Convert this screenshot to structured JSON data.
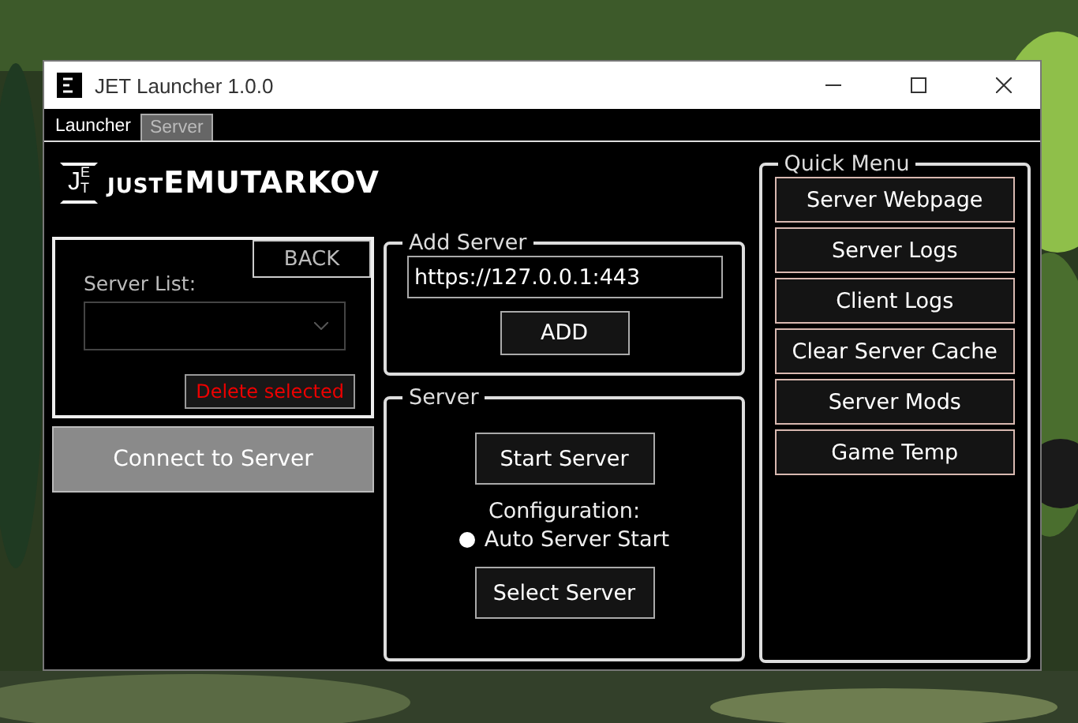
{
  "window": {
    "title": "JET Launcher 1.0.0"
  },
  "tabs": [
    {
      "label": "Launcher",
      "selected": true
    },
    {
      "label": "Server",
      "selected": false
    }
  ],
  "logo": {
    "mark": [
      "J",
      "E",
      "T"
    ],
    "prefix": "JUST",
    "name": "EMUTARKOV"
  },
  "server_list": {
    "back_button": "BACK",
    "label": "Server List:",
    "delete_button": "Delete selected"
  },
  "connect_button": {
    "label": "Connect to Server",
    "disabled": true
  },
  "add_server": {
    "title": "Add Server",
    "value": "https://127.0.0.1:443",
    "button": "ADD"
  },
  "server": {
    "title": "Server",
    "start_button": "Start Server",
    "config_label": "Configuration:",
    "auto_start": {
      "label": "Auto Server Start",
      "checked": false
    },
    "select_button": "Select Server"
  },
  "quick_menu": {
    "title": "Quick Menu",
    "items": [
      "Server Webpage",
      "Server Logs",
      "Client Logs",
      "Clear Server Cache",
      "Server Mods",
      "Game Temp"
    ]
  }
}
